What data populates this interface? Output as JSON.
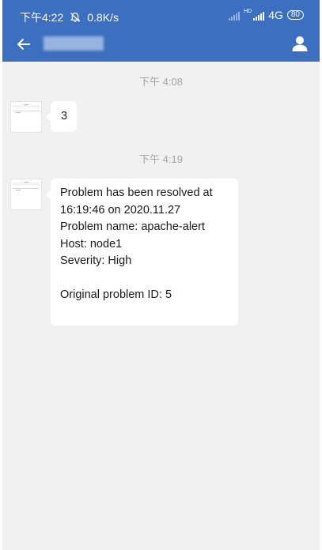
{
  "status_bar": {
    "time": "下午4:22",
    "speed": "0.8K/s",
    "hd_label": "HD",
    "network": "4G",
    "battery": "80"
  },
  "header": {
    "title": "群聊"
  },
  "chat": {
    "messages": [
      {
        "timestamp": "下午 4:08",
        "lines": [
          "3"
        ]
      },
      {
        "timestamp": "下午 4:19",
        "lines": [
          "Problem has been resolved at",
          "16:19:46 on 2020.11.27",
          "Problem name: apache-alert",
          "Host: node1",
          "Severity: High",
          "",
          "Original problem ID: 5"
        ]
      }
    ]
  },
  "colors": {
    "header_bg": "#3d6fc0",
    "chat_bg": "#f1f1f1",
    "bubble_bg": "#ffffff"
  },
  "icons": [
    "bell-muted-icon",
    "signal-icon",
    "battery-icon",
    "back-arrow-icon",
    "user-profile-icon"
  ]
}
